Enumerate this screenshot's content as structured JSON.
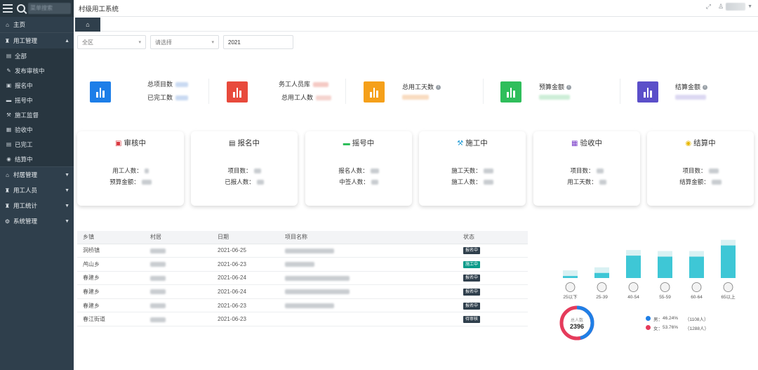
{
  "app": {
    "title": "村级用工系统"
  },
  "sidebar": {
    "search_placeholder": "菜单搜索",
    "items": [
      {
        "label": "主页",
        "icon": "home-icon"
      },
      {
        "label": "用工管理",
        "icon": "labor-icon",
        "expanded": true,
        "children": [
          "全部",
          "发布审核中",
          "报名中",
          "摇号中",
          "施工监督",
          "验收中",
          "已完工",
          "结算中"
        ]
      },
      {
        "label": "村居管理",
        "icon": "village-icon"
      },
      {
        "label": "用工人员",
        "icon": "people-icon"
      },
      {
        "label": "用工统计",
        "icon": "stats-icon"
      },
      {
        "label": "系统管理",
        "icon": "gear-icon"
      }
    ]
  },
  "filters": {
    "region": "全区",
    "select": "请选择",
    "year": "2021"
  },
  "stats": {
    "s1": {
      "label1": "总项目数",
      "label2": "已完工数",
      "color": "#1d7ee8"
    },
    "s2": {
      "label1": "务工人员库",
      "label2": "总用工人数",
      "color": "#e84a3c"
    },
    "s3": {
      "label1": "总用工天数",
      "color": "#f5a01a"
    },
    "s4": {
      "label1": "预算金额",
      "color": "#2fbe5b"
    },
    "s5": {
      "label1": "结算金额",
      "color": "#5b4fc9"
    }
  },
  "cards": [
    {
      "title": "审核中",
      "icon": "audit-icon",
      "row1": "用工人数：",
      "row2": "预算金额："
    },
    {
      "title": "报名中",
      "icon": "signup-icon",
      "row1": "项目数：",
      "row2": "已报人数："
    },
    {
      "title": "摇号中",
      "icon": "lottery-icon",
      "row1": "报名人数：",
      "row2": "中签人数："
    },
    {
      "title": "施工中",
      "icon": "construction-icon",
      "row1": "施工天数：",
      "row2": "施工人数："
    },
    {
      "title": "验收中",
      "icon": "acceptance-icon",
      "row1": "项目数：",
      "row2": "用工天数："
    },
    {
      "title": "结算中",
      "icon": "settlement-icon",
      "row1": "项目数：",
      "row2": "结算金额："
    }
  ],
  "table": {
    "headers": [
      "乡镇",
      "村居",
      "日期",
      "项目名称",
      "状态"
    ],
    "rows": [
      {
        "town": "洞桥镇",
        "date": "2021-06-25",
        "status": "报名中",
        "status_color": "#2f3f4c"
      },
      {
        "town": "鸬山乡",
        "date": "2021-06-23",
        "status": "施工中",
        "status_color": "#0b9b8a"
      },
      {
        "town": "春建乡",
        "date": "2021-06-24",
        "status": "报名中",
        "status_color": "#2f3f4c"
      },
      {
        "town": "春建乡",
        "date": "2021-06-24",
        "status": "报名中",
        "status_color": "#2f3f4c"
      },
      {
        "town": "春建乡",
        "date": "2021-06-23",
        "status": "报名中",
        "status_color": "#2f3f4c"
      },
      {
        "town": "春江街道",
        "date": "2021-06-23",
        "status": "待审核",
        "status_color": "#2f3f4c"
      }
    ]
  },
  "chart_data": {
    "type": "bar",
    "categories": [
      "25以下",
      "25-39",
      "40-54",
      "55-59",
      "60-64",
      "65以上"
    ],
    "values": [
      2,
      5,
      22,
      21,
      21,
      32
    ],
    "ylim": [
      0,
      40
    ],
    "color": "#3ec7d6"
  },
  "gender": {
    "total_label": "总人数",
    "total": "2396",
    "male_label": "男：",
    "male_pct": "46.24%",
    "male_count": "（1108人）",
    "male_color": "#1f7fe6",
    "female_label": "女：",
    "female_pct": "53.76%",
    "female_count": "（1288人）",
    "female_color": "#e53b5b"
  }
}
